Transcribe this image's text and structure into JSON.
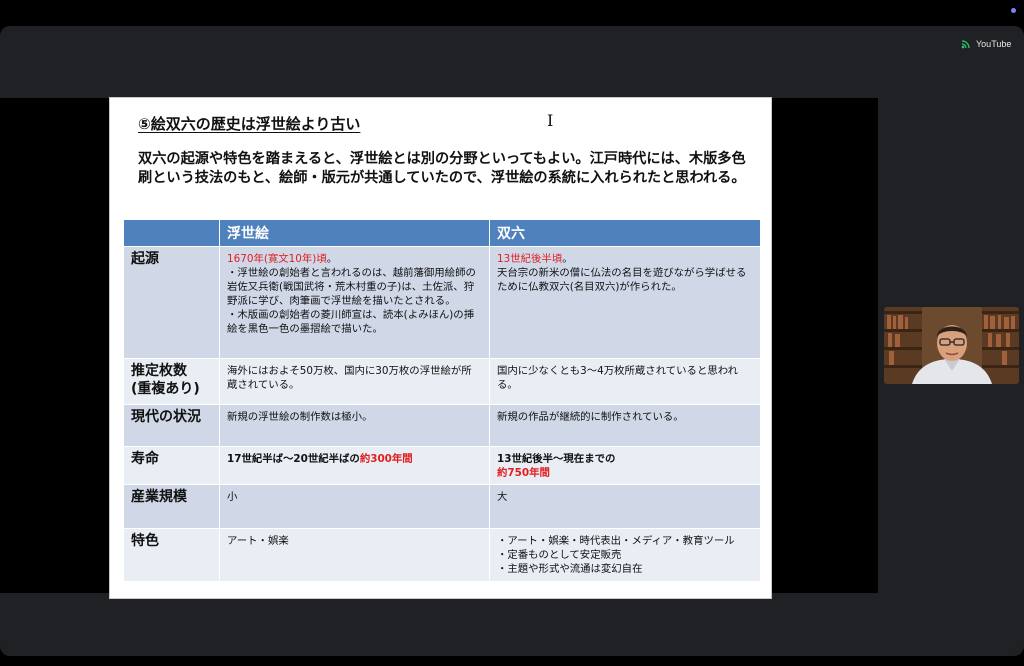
{
  "app": {
    "source_label": "YouTube"
  },
  "slide": {
    "title": "⑤絵双六の歴史は浮世絵より古い",
    "intro": "双六の起源や特色を踏まえると、浮世絵とは別の分野といってもよい。江戸時代には、木版多色刷という技法のもと、絵師・版元が共通していたので、浮世絵の系統に入れられたと思われる。",
    "table": {
      "headers": [
        "",
        "浮世絵",
        "双六"
      ],
      "rows": {
        "origin": {
          "label": "起源",
          "ukiyoe": {
            "date": "1670年(寛文10年)頃",
            "date_suffix": "。",
            "lines": [
              "・浮世絵の創始者と言われるのは、越前藩御用絵師の岩佐又兵衛(戦国武将・荒木村重の子)は、土佐派、狩野派に学び、肉筆画で浮世絵を描いたとされる。",
              "・木版画の創始者の菱川師宣は、読本(よみほん)の挿絵を黒色一色の墨摺絵で描いた。"
            ]
          },
          "sugoroku": {
            "date": "13世紀後半頃",
            "date_suffix": "。",
            "text": "天台宗の新米の僧に仏法の名目を遊びながら学ばせるために仏教双六(名目双六)が作られた。"
          }
        },
        "count": {
          "label_line1": "推定枚数",
          "label_line2": "(重複あり)",
          "ukiyoe": "海外にはおよそ50万枚、国内に30万枚の浮世絵が所蔵されている。",
          "sugoroku": "国内に少なくとも3～4万枚所蔵されていると思われる。"
        },
        "current": {
          "label": "現代の状況",
          "ukiyoe": "新規の浮世絵の制作数は極小。",
          "sugoroku": "新規の作品が継続的に制作されている。"
        },
        "lifespan": {
          "label": "寿命",
          "ukiyoe_prefix": "17世紀半ば～20世紀半ばの",
          "ukiyoe_highlight": "約300年間",
          "sugoroku_prefix": "13世紀後半～現在までの",
          "sugoroku_highlight": "約750年間"
        },
        "scale": {
          "label": "産業規模",
          "ukiyoe": "小",
          "sugoroku": "大"
        },
        "feature": {
          "label": "特色",
          "ukiyoe": "アート・娯楽",
          "sugoroku_lines": [
            "・アート・娯楽・時代表出・メディア・教育ツール",
            "・定番ものとして安定販売",
            "・主題や形式や流通は変幻自在"
          ]
        }
      }
    }
  },
  "colors": {
    "header_blue": "#4f81bd",
    "row_dark": "#d0d8e8",
    "row_light": "#e9edf4",
    "highlight_red": "#e02020"
  },
  "icons": {
    "source": "broadcast-icon",
    "cursor": "text-cursor-icon"
  }
}
